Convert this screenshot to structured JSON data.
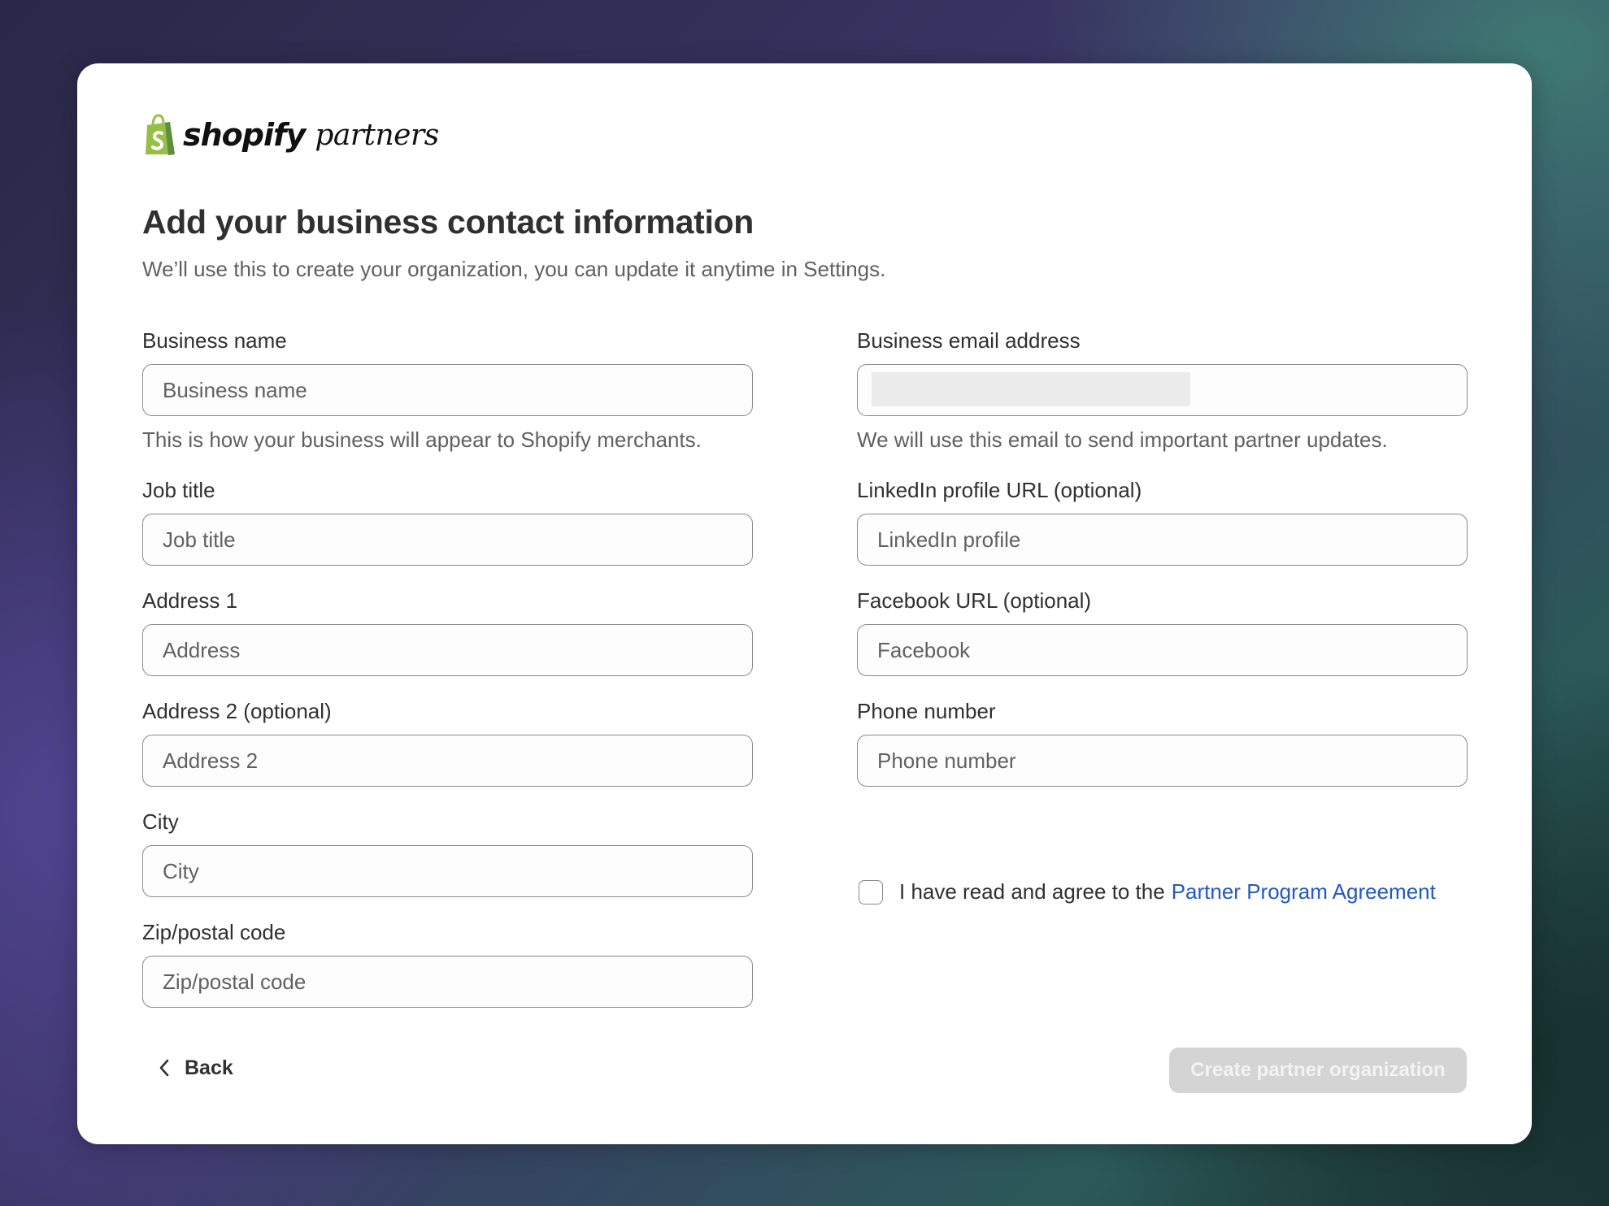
{
  "brand": {
    "name": "shopify",
    "product": "partners",
    "bag_color": "#95bf47"
  },
  "header": {
    "title": "Add your business contact information",
    "subtitle": "We’ll use this to create your organization, you can update it anytime in Settings."
  },
  "form": {
    "left": {
      "business_name": {
        "label": "Business name",
        "placeholder": "Business name",
        "help": "This is how your business will appear to Shopify merchants."
      },
      "job_title": {
        "label": "Job title",
        "placeholder": "Job title"
      },
      "address1": {
        "label": "Address 1",
        "placeholder": "Address"
      },
      "address2": {
        "label": "Address 2 (optional)",
        "placeholder": "Address 2"
      },
      "city": {
        "label": "City",
        "placeholder": "City"
      },
      "zip": {
        "label": "Zip/postal code",
        "placeholder": "Zip/postal code"
      }
    },
    "right": {
      "email": {
        "label": "Business email address",
        "help": "We will use this email to send important partner updates."
      },
      "linkedin": {
        "label": "LinkedIn profile URL (optional)",
        "placeholder": "LinkedIn profile"
      },
      "facebook": {
        "label": "Facebook URL (optional)",
        "placeholder": "Facebook"
      },
      "phone": {
        "label": "Phone number",
        "placeholder": "Phone number"
      },
      "agreement": {
        "text": "I have read and agree to the",
        "link": "Partner Program Agreement",
        "checked": false
      }
    }
  },
  "footer": {
    "back_label": "Back",
    "back_icon": "chevron-left-icon",
    "submit_label": "Create partner organization",
    "submit_disabled": true
  },
  "colors": {
    "link": "#2457c5",
    "text": "#303030",
    "muted": "#616161",
    "disabled_button": "#d4d4d4"
  }
}
